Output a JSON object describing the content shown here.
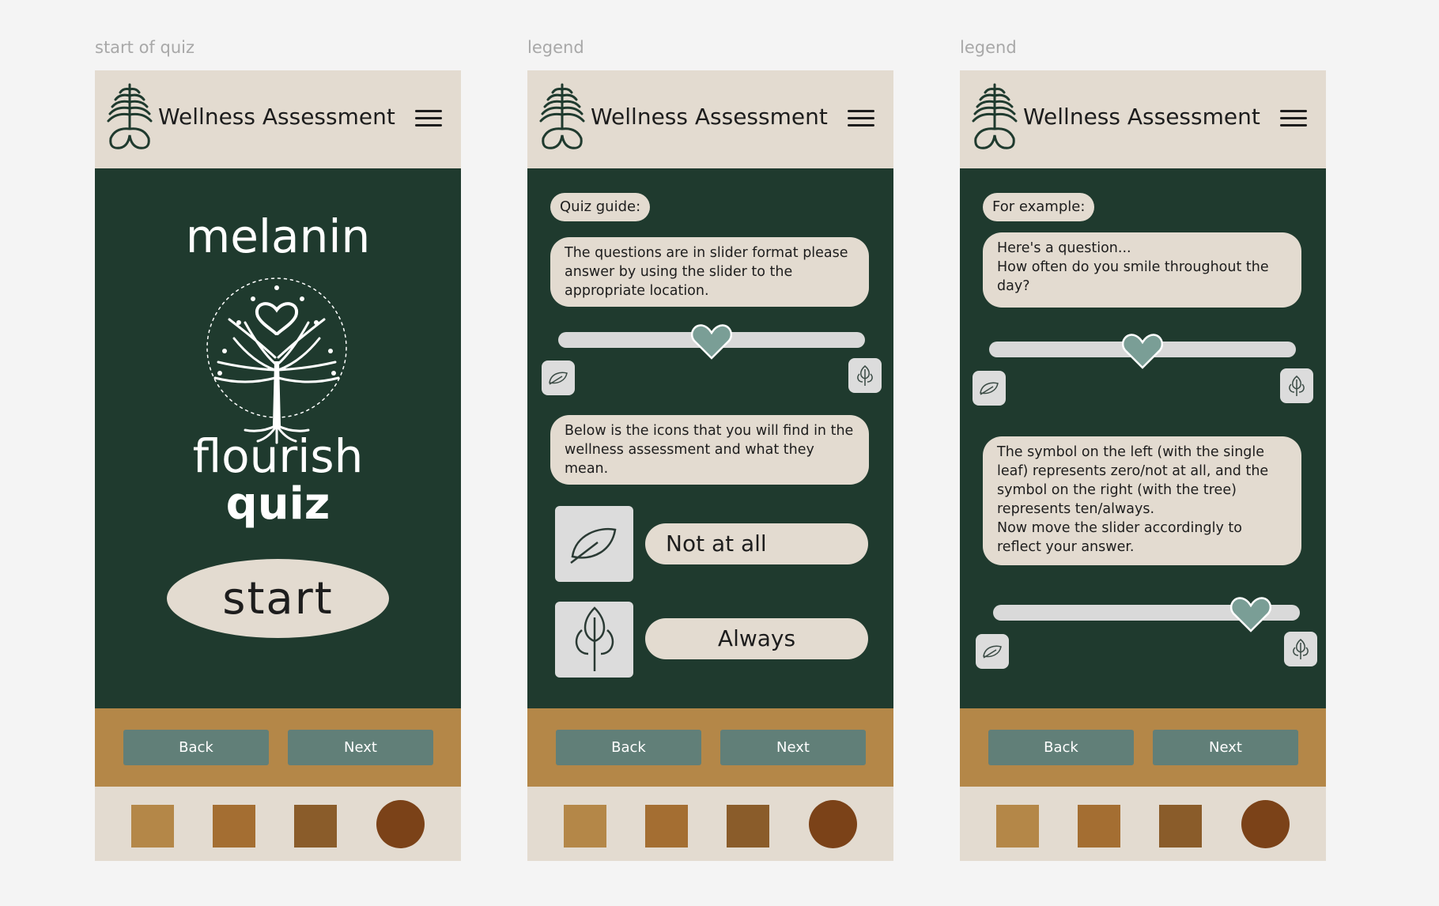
{
  "frames": [
    {
      "label": "start of quiz"
    },
    {
      "label": "legend"
    },
    {
      "label": "legend"
    }
  ],
  "header": {
    "title": "Wellness Assessment"
  },
  "start_screen": {
    "word1": "melanin",
    "word2": "flourish",
    "word3": "quiz",
    "start_label": "start"
  },
  "legend_screen": {
    "guide_label": "Quiz guide:",
    "guide_text": "The questions are in slider format please answer by using the slider to the appropriate location.",
    "icons_text": "Below is the icons that you will find in the wellness assessment and what they mean.",
    "legend_items": [
      {
        "label": "Not at all",
        "icon": "leaf-icon"
      },
      {
        "label": "Always",
        "icon": "tree-icon"
      }
    ],
    "slider_value": 0.5
  },
  "example_screen": {
    "example_label": "For example:",
    "question_text": "Here's a question...\nHow often do you smile throughout the day?",
    "explain_text": "The symbol on the left (with the single leaf) represents zero/not at all, and the symbol on the right (with the tree) represents ten/always.\nNow move the slider accordingly to reflect your answer.",
    "slider1_value": 0.5,
    "slider2_value": 0.84
  },
  "nav": {
    "back_label": "Back",
    "next_label": "Next"
  },
  "colors": {
    "header_bg": "#e3dbd0",
    "body_bg": "#1f3a2e",
    "nav_bg": "#b48748",
    "button_bg": "#617f78",
    "heart": "#7a9e96",
    "swatches": [
      "#b48748",
      "#a46e32",
      "#8a5c2a",
      "#7b4218"
    ]
  }
}
